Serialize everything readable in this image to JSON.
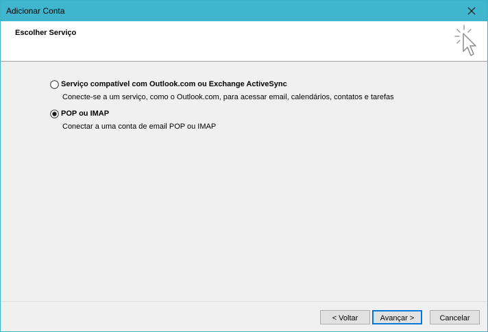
{
  "window": {
    "title": "Adicionar Conta",
    "close_icon": "close-icon"
  },
  "header": {
    "title": "Escolher Serviço",
    "icon": "wizard-cursor-icon"
  },
  "options": [
    {
      "label": "Serviço compatível com Outlook.com ou Exchange ActiveSync",
      "description": "Conecte-se a um serviço, como o Outlook.com, para acessar email, calendários, contatos e tarefas",
      "selected": false
    },
    {
      "label": "POP ou IMAP",
      "description": "Conectar a uma conta de email POP ou IMAP",
      "selected": true
    }
  ],
  "buttons": {
    "back": "< Voltar",
    "next": "Avançar >",
    "cancel": "Cancelar"
  },
  "colors": {
    "titlebar": "#3fb6cd",
    "accent": "#0078d7"
  }
}
